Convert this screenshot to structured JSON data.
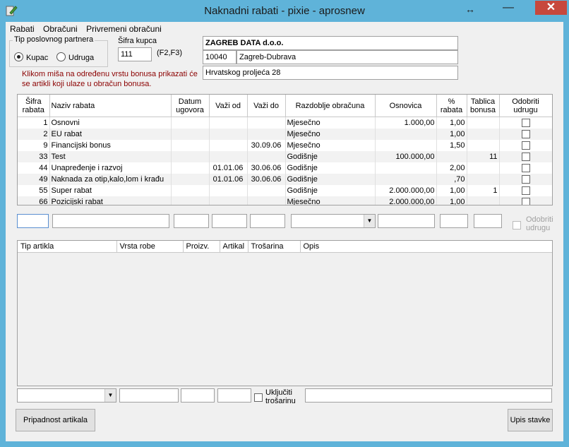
{
  "window": {
    "title": "Naknadni rabati - pixie - aprosnew",
    "resize_glyph": "↔",
    "minimize_glyph": "—",
    "close_glyph": "✕"
  },
  "menu": [
    "Rabati",
    "Obračuni",
    "Privremeni obračuni"
  ],
  "partner_type": {
    "label": "Tip poslovnog partnera",
    "options": [
      "Kupac",
      "Udruga"
    ],
    "selected": "Kupac"
  },
  "customer": {
    "code_label": "Šifra kupca",
    "code_value": "111",
    "shortcut_hint": "(F2,F3)",
    "name": "ZAGREB DATA d.o.o.",
    "postal_code": "10040",
    "city": "Zagreb-Dubrava",
    "address": "Hrvatskog proljeća 28"
  },
  "hint": [
    "Klikom miša na određenu vrstu bonusa prikazati će",
    "se artikli koji ulaze u obračun bonusa."
  ],
  "rebates_table": {
    "headers": [
      "Šifra rabata",
      "Naziv rabata",
      "Datum ugovora",
      "Važi od",
      "Važi do",
      "Razdoblje obračuna",
      "Osnovica",
      "% rabata",
      "Tablica bonusa",
      "Odobriti udrugu"
    ],
    "rows": [
      {
        "code": "1",
        "name": "Osnovni",
        "contract_date": "",
        "valid_from": "",
        "valid_to": "",
        "period": "Mjesečno",
        "base": "1.000,00",
        "percent": "1,00",
        "bonus_table": "",
        "approve": false
      },
      {
        "code": "2",
        "name": "EU rabat",
        "contract_date": "",
        "valid_from": "",
        "valid_to": "",
        "period": "Mjesečno",
        "base": "",
        "percent": "1,00",
        "bonus_table": "",
        "approve": false
      },
      {
        "code": "9",
        "name": "Financijski bonus",
        "contract_date": "",
        "valid_from": "",
        "valid_to": "30.09.06",
        "period": "Mjesečno",
        "base": "",
        "percent": "1,50",
        "bonus_table": "",
        "approve": false
      },
      {
        "code": "33",
        "name": "Test",
        "contract_date": "",
        "valid_from": "",
        "valid_to": "",
        "period": "Godišnje",
        "base": "100.000,00",
        "percent": "",
        "bonus_table": "11",
        "approve": false
      },
      {
        "code": "44",
        "name": "Unapređenje i razvoj",
        "contract_date": "",
        "valid_from": "01.01.06",
        "valid_to": "30.06.06",
        "period": "Godišnje",
        "base": "",
        "percent": "2,00",
        "bonus_table": "",
        "approve": false
      },
      {
        "code": "49",
        "name": "Naknada za otip,kalo,lom i krađu",
        "contract_date": "",
        "valid_from": "01.01.06",
        "valid_to": "30.06.06",
        "period": "Godišnje",
        "base": "",
        "percent": ",70",
        "bonus_table": "",
        "approve": false
      },
      {
        "code": "55",
        "name": "Super rabat",
        "contract_date": "",
        "valid_from": "",
        "valid_to": "",
        "period": "Godišnje",
        "base": "2.000.000,00",
        "percent": "1,00",
        "bonus_table": "1",
        "approve": false
      },
      {
        "code": "66",
        "name": "Pozicijski rabat",
        "contract_date": "",
        "valid_from": "",
        "valid_to": "",
        "period": "Mjesečno",
        "base": "2.000.000,00",
        "percent": "1,00",
        "bonus_table": "",
        "approve": false
      }
    ]
  },
  "edit_row": {
    "approve_label": [
      "Odobriti",
      "udrugu"
    ]
  },
  "articles_table": {
    "headers": [
      "Tip artikla",
      "Vrsta robe",
      "Proizv.",
      "Artikal",
      "Trošarina",
      "Opis"
    ]
  },
  "articles_edit": {
    "excise_label": [
      "Uključiti",
      "trošarinu"
    ]
  },
  "buttons": {
    "article_membership": "Pripadnost artikala",
    "save_item": "Upis stavke"
  },
  "icons": {
    "app": "pencil-icon",
    "dropdown": "chevron-down-icon"
  }
}
